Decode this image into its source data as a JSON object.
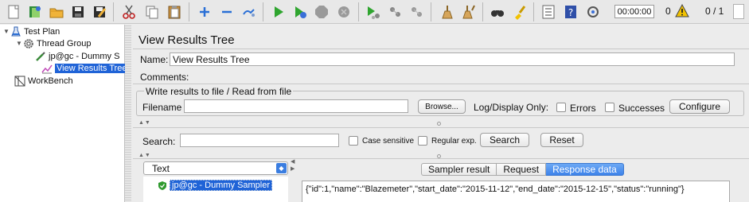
{
  "toolbar": {
    "buttons": [
      "new-icon",
      "templates-icon",
      "open-icon",
      "save-icon",
      "save-as-icon",
      "cut-icon",
      "copy-icon",
      "paste-icon",
      "expand-icon",
      "collapse-icon",
      "toggle-icon",
      "start-icon",
      "start-no-pauses-icon",
      "stop-icon",
      "shutdown-icon",
      "remote-start-icon",
      "remote-stop-icon",
      "remote-shutdown-icon",
      "clear-icon",
      "clear-all-icon",
      "search-icon",
      "reset-search-icon",
      "function-helper-icon",
      "help-icon",
      "options-icon"
    ],
    "timer": "00:00:00",
    "error_count": "0",
    "threads": "0 / 1",
    "warning_color": "#f2c200"
  },
  "tree": {
    "items": [
      {
        "label": "Test Plan",
        "icon": "flask-icon"
      },
      {
        "label": "Thread Group",
        "icon": "gear-icon"
      },
      {
        "label": "jp@gc - Dummy S",
        "icon": "pipette-icon"
      },
      {
        "label": "View Results Tree",
        "icon": "graph-icon",
        "selected": true
      },
      {
        "label": "WorkBench",
        "icon": "workbench-icon"
      }
    ]
  },
  "panel": {
    "title": "View Results Tree",
    "name_label": "Name:",
    "name_value": "View Results Tree",
    "comments_label": "Comments:",
    "file_group": {
      "legend": "Write results to file / Read from file",
      "filename_label": "Filename",
      "filename_value": "",
      "browse_label": "Browse...",
      "log_display_label": "Log/Display Only:",
      "errors_label": "Errors",
      "successes_label": "Successes",
      "configure_label": "Configure"
    },
    "search": {
      "label": "Search:",
      "value": "",
      "case_sensitive_label": "Case sensitive",
      "regex_label": "Regular exp.",
      "search_button": "Search",
      "reset_button": "Reset"
    },
    "renderer": {
      "selected": "Text"
    },
    "results": [
      {
        "label": "jp@gc - Dummy Sampler",
        "status": "success"
      }
    ],
    "tabs": [
      "Sampler result",
      "Request",
      "Response data"
    ],
    "active_tab": "Response data",
    "response_text": "{\"id\":1,\"name\":\"Blazemeter\",\"start_date\":\"2015-11-12\",\"end_date\":\"2015-12-15\",\"status\":\"running\"}"
  }
}
